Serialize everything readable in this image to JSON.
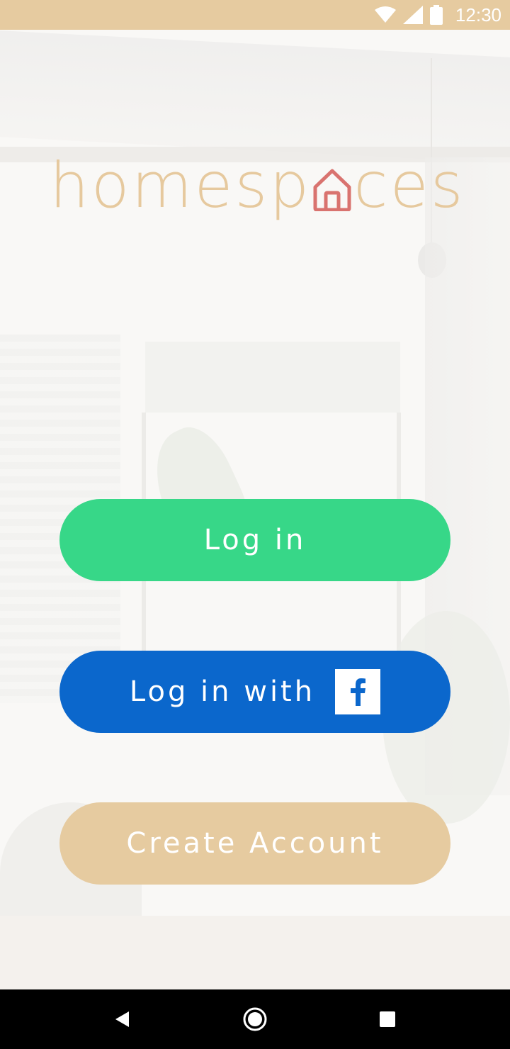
{
  "status_bar": {
    "time": "12:30",
    "icons": [
      "wifi-icon",
      "cell-signal-icon",
      "battery-icon"
    ],
    "background": "#e6cba0"
  },
  "logo": {
    "text_before": "homesp",
    "text_after": "ces",
    "icon": "house-icon",
    "text_color": "#e6c99e",
    "icon_color": "#d9736f"
  },
  "buttons": {
    "login": {
      "label": "Log in",
      "color": "#37d788"
    },
    "facebook": {
      "label": "Log in with",
      "icon": "facebook-icon",
      "color": "#0b67cc"
    },
    "create_account": {
      "label": "Create Account",
      "color": "#e6cba0"
    }
  },
  "nav_bar": {
    "items": [
      "back-icon",
      "home-icon",
      "recents-icon"
    ]
  }
}
